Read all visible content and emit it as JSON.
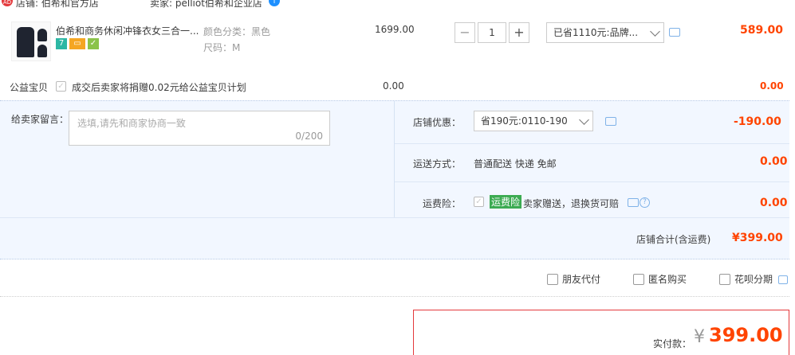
{
  "shop": {
    "label": "店铺: 伯希和官方店",
    "seller": "卖家: pelliot伯希和企业店"
  },
  "item": {
    "title": "伯希和商务休闲冲锋衣女三合一...",
    "sku": {
      "color": "颜色分类：黑色",
      "size": "尺码：M"
    },
    "price": "1699.00",
    "quantity": "1",
    "minus": "−",
    "plus": "+",
    "discount_select": "已省1110元:品牌...",
    "subtotal": "589.00",
    "badges": [
      {
        "icon": "seven-day-return-icon",
        "text": "7",
        "color": "#2db7a4"
      },
      {
        "icon": "credit-card-icon",
        "text": "▭",
        "color": "#f5a623"
      },
      {
        "icon": "guarantee-icon",
        "text": "✓",
        "color": "#8bc34a"
      }
    ]
  },
  "charity": {
    "label": "公益宝贝",
    "text": "成交后卖家将捐赠0.02元给公益宝贝计划",
    "price": "0.00",
    "amount": "0.00"
  },
  "memo": {
    "label": "给卖家留言：",
    "placeholder": "选填,请先和商家协商一致",
    "count": "0/200"
  },
  "shop_discount": {
    "label": "店铺优惠：",
    "value": "省190元:0110-190",
    "amount": "-190.00"
  },
  "shipping": {
    "label": "运送方式：",
    "value": "普通配送 快递 免邮",
    "amount": "0.00"
  },
  "insurance": {
    "label": "运费险：",
    "tag": "运费险",
    "text": "卖家赠送，退换货可赔",
    "amount": "0.00",
    "help": "?"
  },
  "shop_total": {
    "label": "店铺合计(含运费)",
    "amount": "¥399.00"
  },
  "options": [
    {
      "name": "friend-pay",
      "label": "朋友代付"
    },
    {
      "name": "anonymous",
      "label": "匿名购买"
    },
    {
      "name": "huabei",
      "label": "花呗分期"
    }
  ],
  "payment": {
    "label": "实付款：",
    "currency": "¥",
    "amount": "399.00"
  },
  "colors": {
    "accent": "#ff4400",
    "panel": "#f2f7ff",
    "border": "#e4393c"
  }
}
